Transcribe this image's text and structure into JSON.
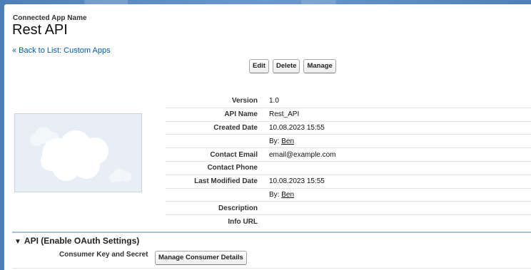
{
  "header": {
    "label": "Connected App Name",
    "title": "Rest API"
  },
  "back_link": "« Back to List: Custom Apps",
  "toolbar": {
    "edit_label": "Edit",
    "delete_label": "Delete",
    "manage_label": "Manage"
  },
  "details": {
    "version_label": "Version",
    "version": "1.0",
    "api_name_label": "API Name",
    "api_name": "Rest_API",
    "created_date_label": "Created Date",
    "created_date": "10.08.2023 15:55",
    "by_prefix": "By:",
    "created_by": "Ben",
    "contact_email_label": "Contact Email",
    "contact_email": "email@example.com",
    "contact_phone_label": "Contact Phone",
    "last_modified_label": "Last Modified Date",
    "last_modified": "10.08.2023 15:55",
    "modified_by": "Ben",
    "description_label": "Description",
    "info_url_label": "Info URL"
  },
  "api_section": {
    "title": "API (Enable OAuth Settings)",
    "consumer_label": "Consumer Key and Secret",
    "manage_consumer_label": "Manage Consumer Details"
  },
  "icons": {
    "logo": "cloud-logo-icon",
    "section_toggle": "triangle-down-icon"
  },
  "colors": {
    "link": "#015ba7",
    "section_rule": "#a9bfd8"
  }
}
